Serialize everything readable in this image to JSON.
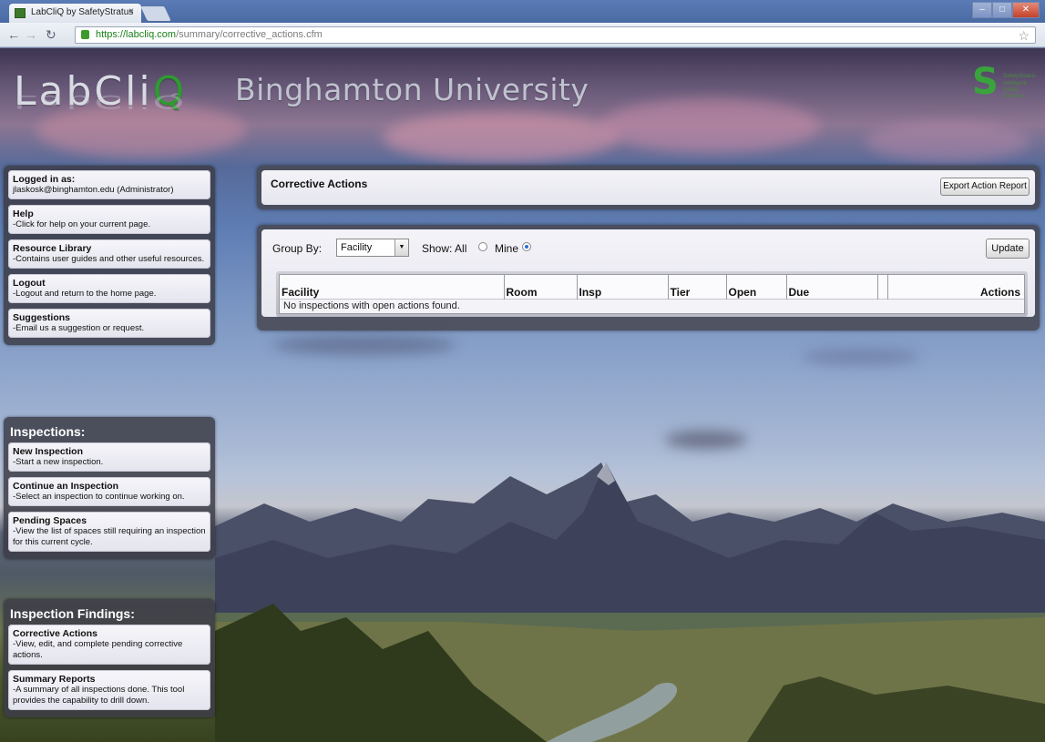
{
  "browser": {
    "tab_title": "LabCliQ by SafetyStratus",
    "tab_close": "×",
    "url_scheme": "https://",
    "url_host": "labcliq.com",
    "url_path": "/summary/corrective_actions.cfm"
  },
  "header": {
    "logo_prefix": "LabCl",
    "logo_i": "i",
    "logo_q": "Q",
    "university": "Binghamton University",
    "brand_line1": "SafetyStratus",
    "brand_line2": "Intelligent Safety Solutions"
  },
  "sidebar": {
    "account": [
      {
        "title": "Logged in as:",
        "desc": "jlaskosk@binghamton.edu (Administrator)"
      },
      {
        "title": "Help",
        "desc": "-Click for help on your current page."
      },
      {
        "title": "Resource Library",
        "desc": "-Contains user guides and other useful resources."
      },
      {
        "title": "Logout",
        "desc": "-Logout and return to the home page."
      },
      {
        "title": "Suggestions",
        "desc": "-Email us a suggestion or request."
      }
    ],
    "inspections": {
      "heading": "Inspections:",
      "items": [
        {
          "title": "New Inspection",
          "desc": "-Start a new inspection."
        },
        {
          "title": "Continue an Inspection",
          "desc": "-Select an inspection to continue working on."
        },
        {
          "title": "Pending Spaces",
          "desc": "-View the list of spaces still requiring an inspection for this current cycle."
        }
      ]
    },
    "findings": {
      "heading": "Inspection Findings:",
      "items": [
        {
          "title": "Corrective Actions",
          "desc": "-View, edit, and complete pending corrective actions."
        },
        {
          "title": "Summary Reports",
          "desc": "-A summary of all inspections done. This tool provides the capability to drill down."
        }
      ]
    }
  },
  "main": {
    "title": "Corrective Actions",
    "export_label": "Export Action Report",
    "filter": {
      "group_by_label": "Group By:",
      "group_by_value": "Facility",
      "show_label": "Show: All",
      "mine_label": "Mine",
      "selected": "Mine",
      "update_label": "Update"
    },
    "table": {
      "columns": [
        "Facility",
        "Room",
        "Insp",
        "Tier",
        "Open",
        "Due",
        "",
        "Actions"
      ],
      "empty_message": "No inspections with open actions found."
    }
  },
  "colors": {
    "logo_green": "#2f9a32",
    "radio_selected": "#2b6fd6"
  }
}
